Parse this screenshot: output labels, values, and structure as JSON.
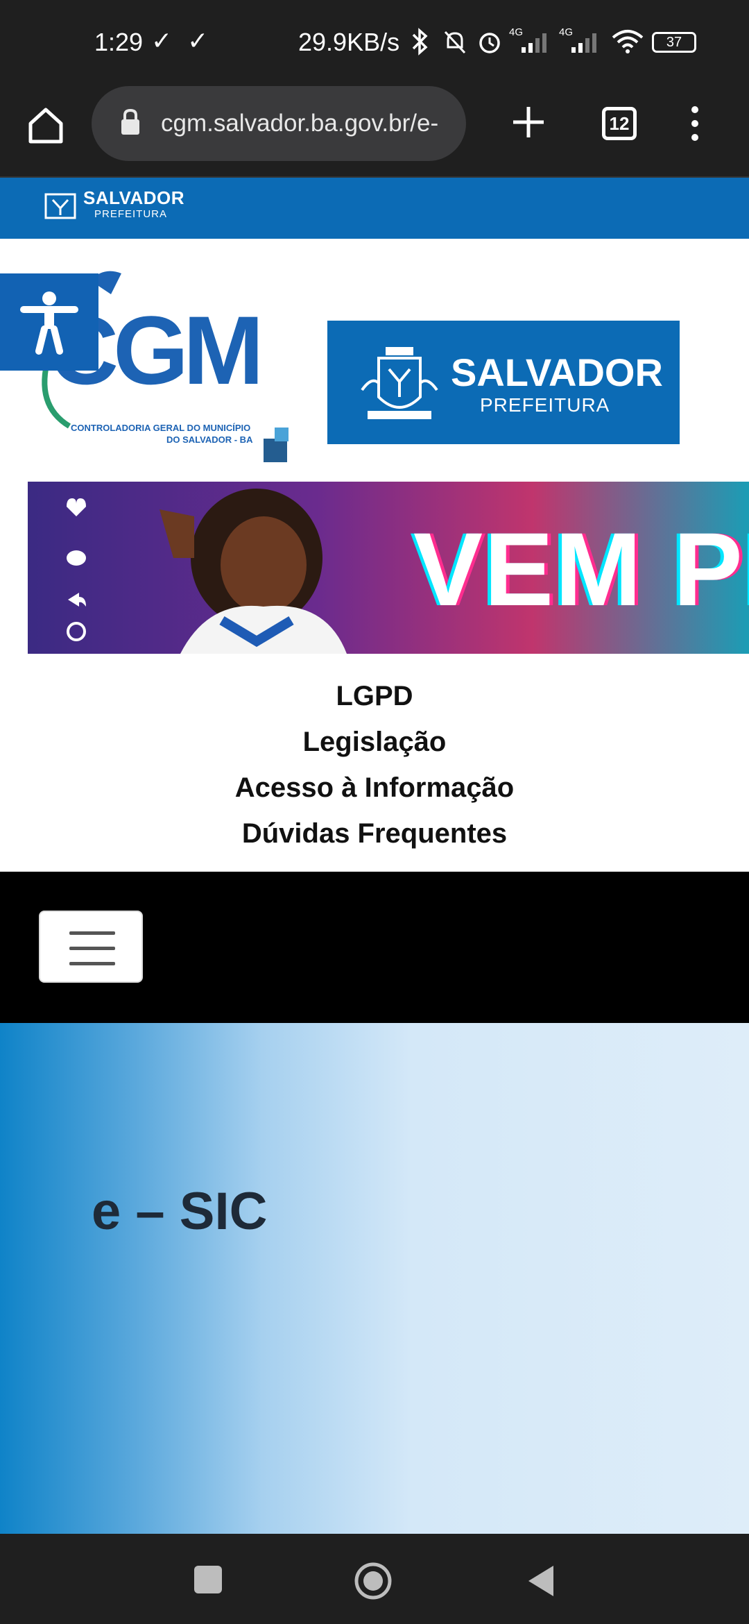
{
  "status_bar": {
    "time": "1:29",
    "checks": "✓ ✓",
    "network_speed": "29.9KB/s",
    "network_type_1": "4G",
    "network_type_2": "4G",
    "battery": "37"
  },
  "browser": {
    "url": "cgm.salvador.ba.gov.br/e-",
    "tab_count": "12"
  },
  "gov_strip": {
    "title": "SALVADOR",
    "subtitle": "PREFEITURA"
  },
  "logos": {
    "cgm_text": "CGM",
    "cgm_sub_line1": "CONTROLADORIA GERAL DO MUNICÍPIO",
    "cgm_sub_line2": "DO SALVADOR - BA",
    "salvador_title": "SALVADOR",
    "salvador_sub": "PREFEITURA"
  },
  "banner": {
    "text": "VEM PR"
  },
  "top_links": [
    "LGPD",
    "Legislação",
    "Acesso à Informação",
    "Dúvidas Frequentes"
  ],
  "hero": {
    "title": "e – SIC"
  },
  "colors": {
    "brand_blue": "#0c6bb5",
    "dark_bar": "#1f1f1f"
  }
}
